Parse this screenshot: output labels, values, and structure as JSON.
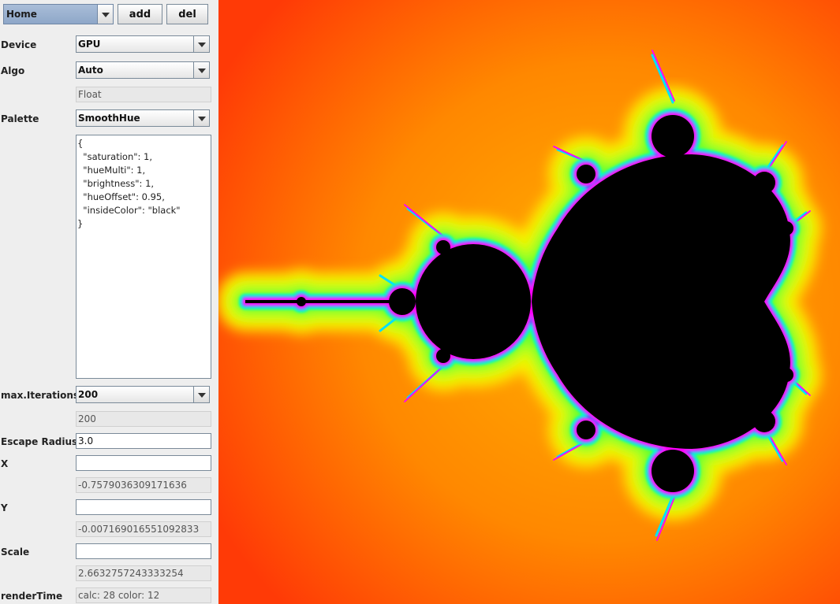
{
  "toolbar": {
    "preset_value": "Home",
    "add_label": "add",
    "del_label": "del"
  },
  "device": {
    "label": "Device",
    "value": "GPU"
  },
  "algo": {
    "label": "Algo",
    "value": "Auto",
    "precision": "Float"
  },
  "palette": {
    "label": "Palette",
    "value": "SmoothHue",
    "config": "{\n  \"saturation\": 1,\n  \"hueMulti\": 1,\n  \"brightness\": 1,\n  \"hueOffset\": 0.95,\n  \"insideColor\": \"black\"\n}"
  },
  "max_iterations": {
    "label": "max.Iterations",
    "value": "200",
    "current": "200"
  },
  "escape_radius": {
    "label": "Escape Radius",
    "value": "3.0"
  },
  "x": {
    "label": "X",
    "input": "",
    "current": "-0.7579036309171636"
  },
  "y": {
    "label": "Y",
    "input": "",
    "current": "-0.007169016551092833"
  },
  "scale": {
    "label": "Scale",
    "input": "",
    "current": "2.6632757243333254"
  },
  "render_time": {
    "label": "renderTime",
    "value": "calc: 28 color: 12"
  },
  "fractal": {
    "inside_color": "#000000",
    "outer_color": "#ff3a06",
    "glow_colors": [
      "#ff6a00",
      "#ffb800",
      "#ffff00",
      "#aaff00",
      "#33ff33",
      "#00ffcc",
      "#3355ff",
      "#ff00ff"
    ]
  }
}
